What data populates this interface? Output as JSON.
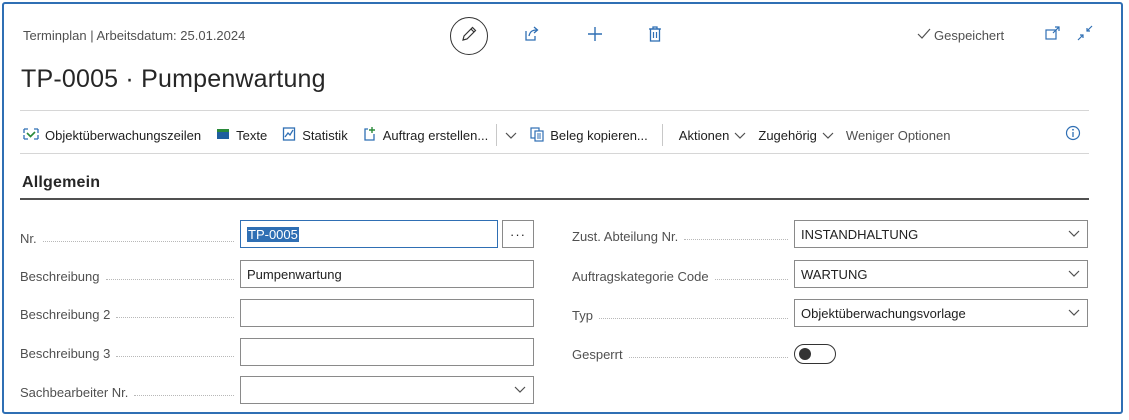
{
  "header": {
    "breadcrumb": "Terminplan | Arbeitsdatum: 25.01.2024",
    "title": "TP-0005 · Pumpenwartung",
    "status": "Gespeichert",
    "icons": [
      "edit-icon",
      "share-icon",
      "plus-icon",
      "delete-icon",
      "open-new-window-icon",
      "collapse-icon"
    ]
  },
  "actions": {
    "items": [
      {
        "label": "Objektüberwachungszeilen",
        "icon": "lines-icon"
      },
      {
        "label": "Texte",
        "icon": "notes-icon"
      },
      {
        "label": "Statistik",
        "icon": "statistics-icon"
      },
      {
        "label": "Auftrag erstellen...",
        "icon": "create-order-icon"
      },
      {
        "label": "Beleg kopieren...",
        "icon": "copy-document-icon"
      }
    ],
    "menus": [
      "Aktionen",
      "Zugehörig"
    ],
    "fewer_options": "Weniger Optionen"
  },
  "section": {
    "title": "Allgemein"
  },
  "fields_left": [
    {
      "label": "Nr.",
      "value": "TP-0005"
    },
    {
      "label": "Beschreibung",
      "value": "Pumpenwartung"
    },
    {
      "label": "Beschreibung 2",
      "value": ""
    },
    {
      "label": "Beschreibung 3",
      "value": ""
    },
    {
      "label": "Sachbearbeiter Nr.",
      "value": ""
    }
  ],
  "fields_right": [
    {
      "label": "Zust. Abteilung Nr.",
      "value": "INSTANDHALTUNG"
    },
    {
      "label": "Auftragskategorie Code",
      "value": "WARTUNG"
    },
    {
      "label": "Typ",
      "value": "Objektüberwachungsvorlage"
    },
    {
      "label": "Gesperrt",
      "value": "off"
    }
  ],
  "nr_lookup_label": "···"
}
